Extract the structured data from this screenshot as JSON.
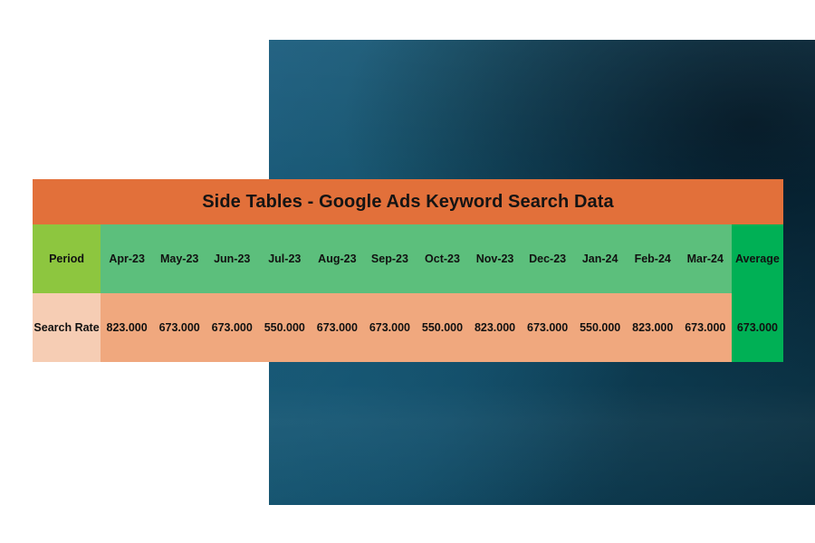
{
  "slide": {
    "background_color": "#ffffff",
    "panel_color_from": "#1b5d7e",
    "panel_color_to": "#0a2e3f"
  },
  "table": {
    "title": "Side Tables - Google Ads Keyword Search Data",
    "title_bar_color": "#e2703a",
    "corner_header": "Period",
    "row_label": "Search Rate",
    "average_header": "Average",
    "average_value": "673.000",
    "header_cell_color": "#5cbf7c",
    "corner_cell_color": "#8dc63f",
    "value_cell_color": "#f0a87e",
    "row_label_cell_color": "#f6cdb4",
    "average_cell_color": "#00b055",
    "columns": [
      "Apr-23",
      "May-23",
      "Jun-23",
      "Jul-23",
      "Aug-23",
      "Sep-23",
      "Oct-23",
      "Nov-23",
      "Dec-23",
      "Jan-24",
      "Feb-24",
      "Mar-24"
    ],
    "values": [
      "823.000",
      "673.000",
      "673.000",
      "550.000",
      "673.000",
      "673.000",
      "550.000",
      "823.000",
      "673.000",
      "550.000",
      "823.000",
      "673.000"
    ]
  },
  "chart_data": {
    "type": "table",
    "title": "Side Tables - Google Ads Keyword Search Data",
    "row_header": "Period",
    "categories": [
      "Apr-23",
      "May-23",
      "Jun-23",
      "Jul-23",
      "Aug-23",
      "Sep-23",
      "Oct-23",
      "Nov-23",
      "Dec-23",
      "Jan-24",
      "Feb-24",
      "Mar-24"
    ],
    "series": [
      {
        "name": "Search Rate",
        "values": [
          823.0,
          673.0,
          673.0,
          550.0,
          673.0,
          673.0,
          550.0,
          823.0,
          673.0,
          550.0,
          823.0,
          673.0
        ]
      }
    ],
    "summary_column": {
      "label": "Average",
      "value": 673.0
    },
    "xlabel": "Period",
    "ylabel": "Search Rate"
  }
}
